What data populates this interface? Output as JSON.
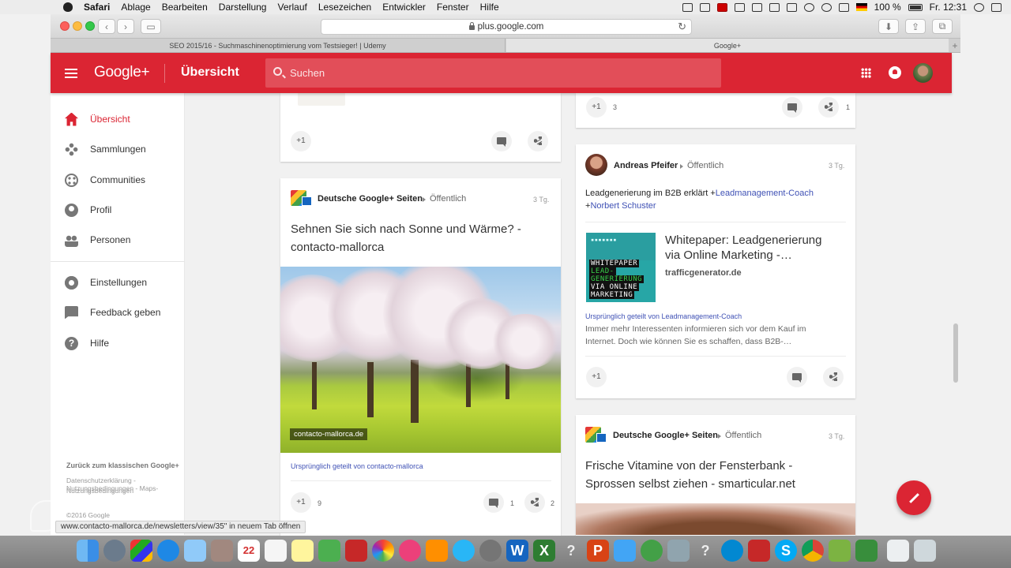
{
  "menubar": {
    "app": "Safari",
    "items": [
      "Ablage",
      "Bearbeiten",
      "Darstellung",
      "Verlauf",
      "Lesezeichen",
      "Entwickler",
      "Fenster",
      "Hilfe"
    ],
    "battery": "100 %",
    "clock": "Fr. 12:31"
  },
  "browser": {
    "url": "plus.google.com",
    "tabs": [
      {
        "title": "SEO 2015/16 - Suchmaschinenoptimierung vom Testsieger! | Udemy"
      },
      {
        "title": "Google+"
      }
    ],
    "status_link": "www.contacto-mallorca.de/newsletters/view/35\" in neuem Tab öffnen"
  },
  "header": {
    "logo": "Google+",
    "title": "Übersicht",
    "search_placeholder": "Suchen"
  },
  "sidebar": {
    "items": [
      {
        "label": "Übersicht",
        "icon": "home-icon",
        "active": true
      },
      {
        "label": "Sammlungen",
        "icon": "collections-icon"
      },
      {
        "label": "Communities",
        "icon": "communities-icon"
      },
      {
        "label": "Profil",
        "icon": "profile-icon"
      },
      {
        "label": "Personen",
        "icon": "people-icon"
      },
      {
        "label": "Einstellungen",
        "icon": "settings-icon"
      },
      {
        "label": "Feedback geben",
        "icon": "feedback-icon"
      },
      {
        "label": "Hilfe",
        "icon": "help-icon"
      }
    ],
    "footer": {
      "classic": "Zurück zum klassischen Google+",
      "links": [
        "Datenschutzerklärung - Nutzungsbedingungen - Maps-",
        "Nutzungsbedingungen"
      ],
      "copyright": "©2016 Google"
    }
  },
  "cards": {
    "top_left": {
      "plus": "+1"
    },
    "top_right": {
      "plus": "+1",
      "plus_count": "3",
      "share_count": "1"
    },
    "left_post": {
      "author": "Deutsche Google+ Seiten",
      "visibility": "Öffentlich",
      "time": "3 Tg.",
      "headline_1": "Sehnen Sie sich nach Sonne und Wärme? -",
      "headline_2": "contacto-mallorca",
      "photo_label": "contacto-mallorca.de",
      "shared_from": "Ursprünglich geteilt von contacto-mallorca",
      "plus": "+1",
      "plus_count": "9",
      "comment_count": "1",
      "share_count": "2"
    },
    "right_post": {
      "author": "Andreas Pfeifer",
      "visibility": "Öffentlich",
      "time": "3 Tg.",
      "text_1": "Leadgenerierung im B2B erklärt +",
      "mention_1": "Leadmanagement-Coach",
      "text_2": "+",
      "mention_2": "Norbert Schuster",
      "link_title_1": "Whitepaper: Leadgenerierung",
      "link_title_2": "via Online Marketing -…",
      "link_domain": "trafficgenerator.de",
      "thumb_lines": [
        "WHITEPAPER",
        "LEAD-",
        "GENERIERUNG",
        "VIA ONLINE",
        "MARKETING"
      ],
      "shared_from": "Ursprünglich geteilt von Leadmanagement-Coach",
      "desc_1": "Immer mehr Interessenten informieren sich vor dem Kauf im",
      "desc_2": "Internet. Doch wie können Sie es schaffen, dass B2B-…",
      "plus": "+1"
    },
    "right_post_2": {
      "author": "Deutsche Google+ Seiten",
      "visibility": "Öffentlich",
      "time": "3 Tg.",
      "headline_1": "Frische Vitamine von der Fensterbank -",
      "headline_2": "Sprossen selbst ziehen - smarticular.net"
    }
  },
  "dock": {
    "calendar_day": "22"
  },
  "colors": {
    "brand": "#db2533",
    "link": "#3f51b5"
  }
}
